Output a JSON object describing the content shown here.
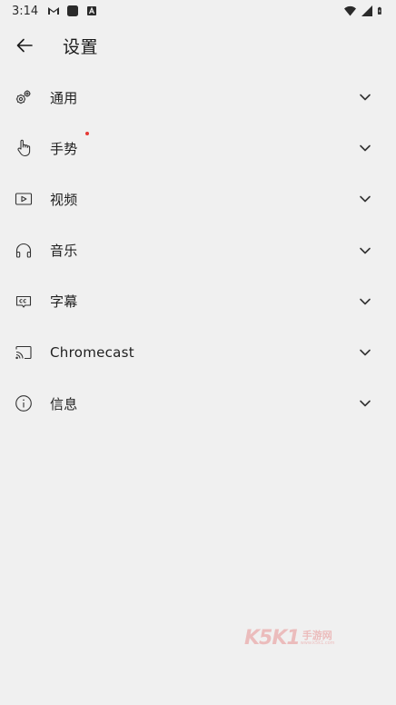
{
  "status_bar": {
    "time": "3:14",
    "left_icons": [
      "gmail-icon",
      "app-square-icon",
      "text-a-icon"
    ],
    "right_icons": [
      "wifi-icon",
      "signal-icon",
      "battery-charging-icon"
    ]
  },
  "header": {
    "title": "设置",
    "back_icon": "arrow-left-icon"
  },
  "settings": {
    "items": [
      {
        "label": "通用",
        "icon": "gears-icon"
      },
      {
        "label": "手势",
        "icon": "hand-pointer-icon",
        "badge": true
      },
      {
        "label": "视频",
        "icon": "video-play-icon"
      },
      {
        "label": "音乐",
        "icon": "headphones-icon"
      },
      {
        "label": "字幕",
        "icon": "closed-caption-icon"
      },
      {
        "label": "Chromecast",
        "icon": "cast-icon"
      },
      {
        "label": "信息",
        "icon": "info-icon"
      }
    ]
  },
  "watermark": {
    "brand": "K5K1",
    "cn": "手游网",
    "url": "www.k5k1.com"
  },
  "colors": {
    "background": "#f0f0f0",
    "badge": "#e53935",
    "text": "#1f1f1f"
  }
}
